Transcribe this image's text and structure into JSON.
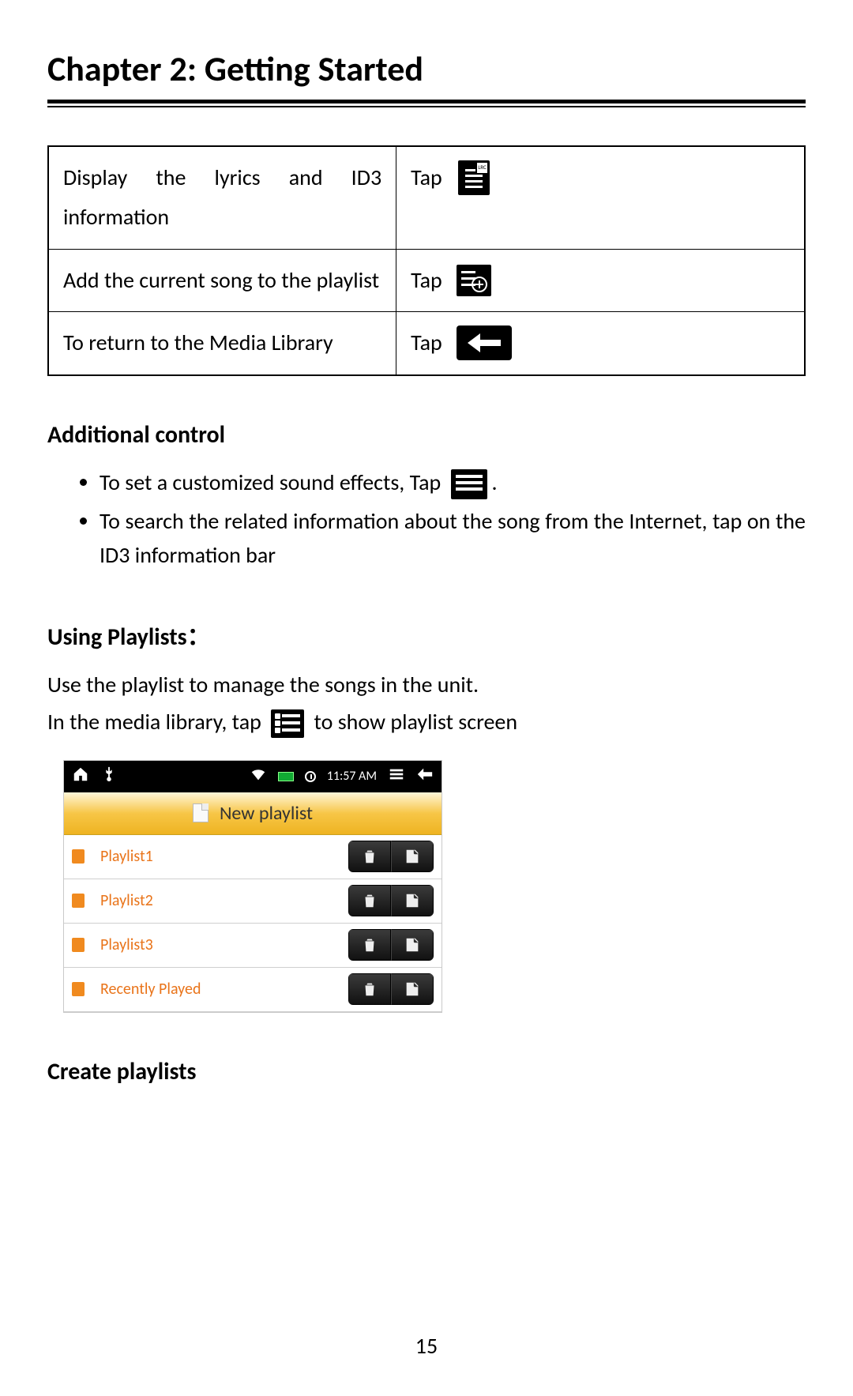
{
  "chapter_title": "Chapter 2: Getting Started",
  "controls_table": {
    "rows": [
      {
        "desc": "Display the lyrics and ID3 information",
        "action": "Tap",
        "icon": "lyrics-icon"
      },
      {
        "desc": "Add the current song to the playlist",
        "action": "Tap",
        "icon": "add-to-playlist-icon"
      },
      {
        "desc": "To return to the Media Library",
        "action": "Tap",
        "icon": "back-icon"
      }
    ]
  },
  "additional_control": {
    "heading": "Additional control",
    "bullets": [
      {
        "prefix": "To set a customized sound effects, Tap",
        "icon": "equalizer-icon",
        "suffix": "."
      },
      {
        "prefix": "To search the related information about the song from the Internet, tap on the ID3 information bar",
        "icon": null,
        "suffix": ""
      }
    ]
  },
  "using_playlists": {
    "heading": "Using Playlists：",
    "intro": "Use the playlist to manage the songs in the unit.",
    "line2_prefix": "In the media library, tap",
    "line2_icon": "playlist-icon",
    "line2_suffix": "to show playlist screen"
  },
  "screenshot": {
    "status_time": "11:57 AM",
    "new_playlist_label": "New playlist",
    "items": [
      {
        "name": "Playlist1"
      },
      {
        "name": "Playlist2"
      },
      {
        "name": "Playlist3"
      },
      {
        "name": "Recently Played"
      }
    ]
  },
  "create_playlists_heading": "Create playlists",
  "page_number": "15"
}
